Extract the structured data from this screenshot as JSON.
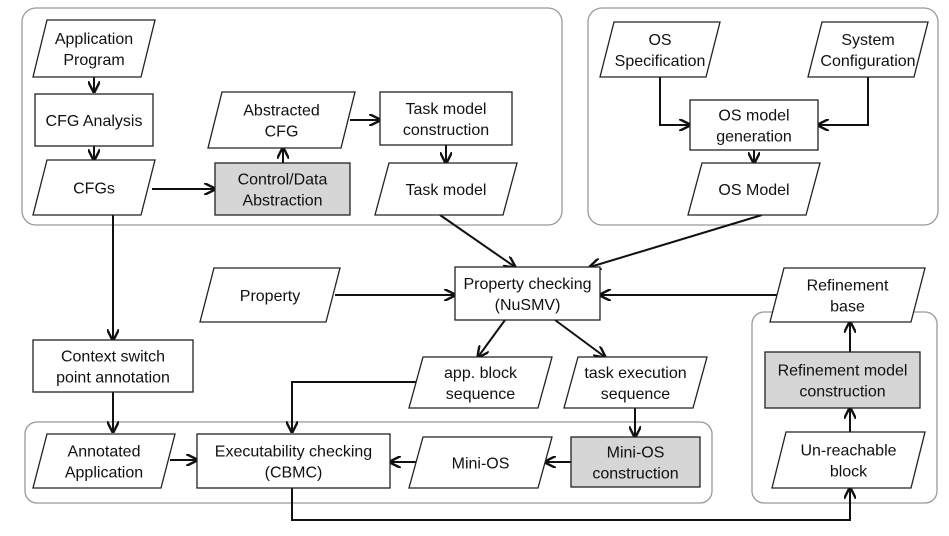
{
  "colors": {
    "highlight_fill": "#d6d6d6",
    "group_border": "#999999",
    "line": "#111111"
  },
  "nodes": {
    "app_program": {
      "shape": "parallelogram",
      "lines": [
        "Application",
        "Program"
      ]
    },
    "cfg_analysis": {
      "shape": "rectangle",
      "lines": [
        "CFG Analysis"
      ]
    },
    "cfgs": {
      "shape": "parallelogram",
      "lines": [
        "CFGs"
      ]
    },
    "control_data_abstraction": {
      "shape": "rectangle",
      "highlighted": true,
      "lines": [
        "Control/Data",
        "Abstraction"
      ]
    },
    "abstracted_cfg": {
      "shape": "parallelogram",
      "lines": [
        "Abstracted",
        "CFG"
      ]
    },
    "task_model_construction": {
      "shape": "rectangle",
      "lines": [
        "Task model",
        "construction"
      ]
    },
    "task_model": {
      "shape": "parallelogram",
      "lines": [
        "Task model"
      ]
    },
    "os_specification": {
      "shape": "parallelogram",
      "lines": [
        "OS",
        "Specification"
      ]
    },
    "system_configuration": {
      "shape": "parallelogram",
      "lines": [
        "System",
        "Configuration"
      ]
    },
    "os_model_generation": {
      "shape": "rectangle",
      "lines": [
        "OS model",
        "generation"
      ]
    },
    "os_model": {
      "shape": "parallelogram",
      "lines": [
        "OS Model"
      ]
    },
    "property": {
      "shape": "parallelogram",
      "lines": [
        "Property"
      ]
    },
    "property_checking": {
      "shape": "rectangle",
      "lines": [
        "Property checking",
        "(NuSMV)"
      ]
    },
    "refinement_base": {
      "shape": "parallelogram",
      "lines": [
        "Refinement",
        "base"
      ]
    },
    "app_block_sequence": {
      "shape": "parallelogram",
      "lines": [
        "app. block",
        "sequence"
      ]
    },
    "task_execution_sequence": {
      "shape": "parallelogram",
      "lines": [
        "task execution",
        "sequence"
      ]
    },
    "context_switch": {
      "shape": "rectangle",
      "lines": [
        "Context switch",
        "point annotation"
      ]
    },
    "refinement_model_construction": {
      "shape": "rectangle",
      "highlighted": true,
      "lines": [
        "Refinement model",
        "construction"
      ]
    },
    "annotated_application": {
      "shape": "parallelogram",
      "lines": [
        "Annotated",
        "Application"
      ]
    },
    "executability_checking": {
      "shape": "rectangle",
      "lines": [
        "Executability checking",
        "(CBMC)"
      ]
    },
    "mini_os": {
      "shape": "parallelogram",
      "lines": [
        "Mini-OS"
      ]
    },
    "mini_os_construction": {
      "shape": "rectangle",
      "highlighted": true,
      "lines": [
        "Mini-OS",
        "construction"
      ]
    },
    "unreachable_block": {
      "shape": "parallelogram",
      "lines": [
        "Un-reachable",
        "block"
      ]
    }
  },
  "edges": [
    [
      "app_program",
      "cfg_analysis"
    ],
    [
      "cfg_analysis",
      "cfgs"
    ],
    [
      "cfgs",
      "control_data_abstraction"
    ],
    [
      "control_data_abstraction",
      "abstracted_cfg"
    ],
    [
      "abstracted_cfg",
      "task_model_construction"
    ],
    [
      "task_model_construction",
      "task_model"
    ],
    [
      "task_model",
      "property_checking"
    ],
    [
      "os_specification",
      "os_model_generation"
    ],
    [
      "system_configuration",
      "os_model_generation"
    ],
    [
      "os_model_generation",
      "os_model"
    ],
    [
      "os_model",
      "property_checking"
    ],
    [
      "property",
      "property_checking"
    ],
    [
      "refinement_base",
      "property_checking"
    ],
    [
      "property_checking",
      "app_block_sequence"
    ],
    [
      "property_checking",
      "task_execution_sequence"
    ],
    [
      "cfgs",
      "context_switch"
    ],
    [
      "context_switch",
      "annotated_application"
    ],
    [
      "app_block_sequence",
      "executability_checking"
    ],
    [
      "annotated_application",
      "executability_checking"
    ],
    [
      "mini_os",
      "executability_checking"
    ],
    [
      "task_execution_sequence",
      "mini_os_construction"
    ],
    [
      "mini_os_construction",
      "mini_os"
    ],
    [
      "executability_checking",
      "unreachable_block"
    ],
    [
      "unreachable_block",
      "refinement_model_construction"
    ],
    [
      "refinement_model_construction",
      "refinement_base"
    ]
  ]
}
